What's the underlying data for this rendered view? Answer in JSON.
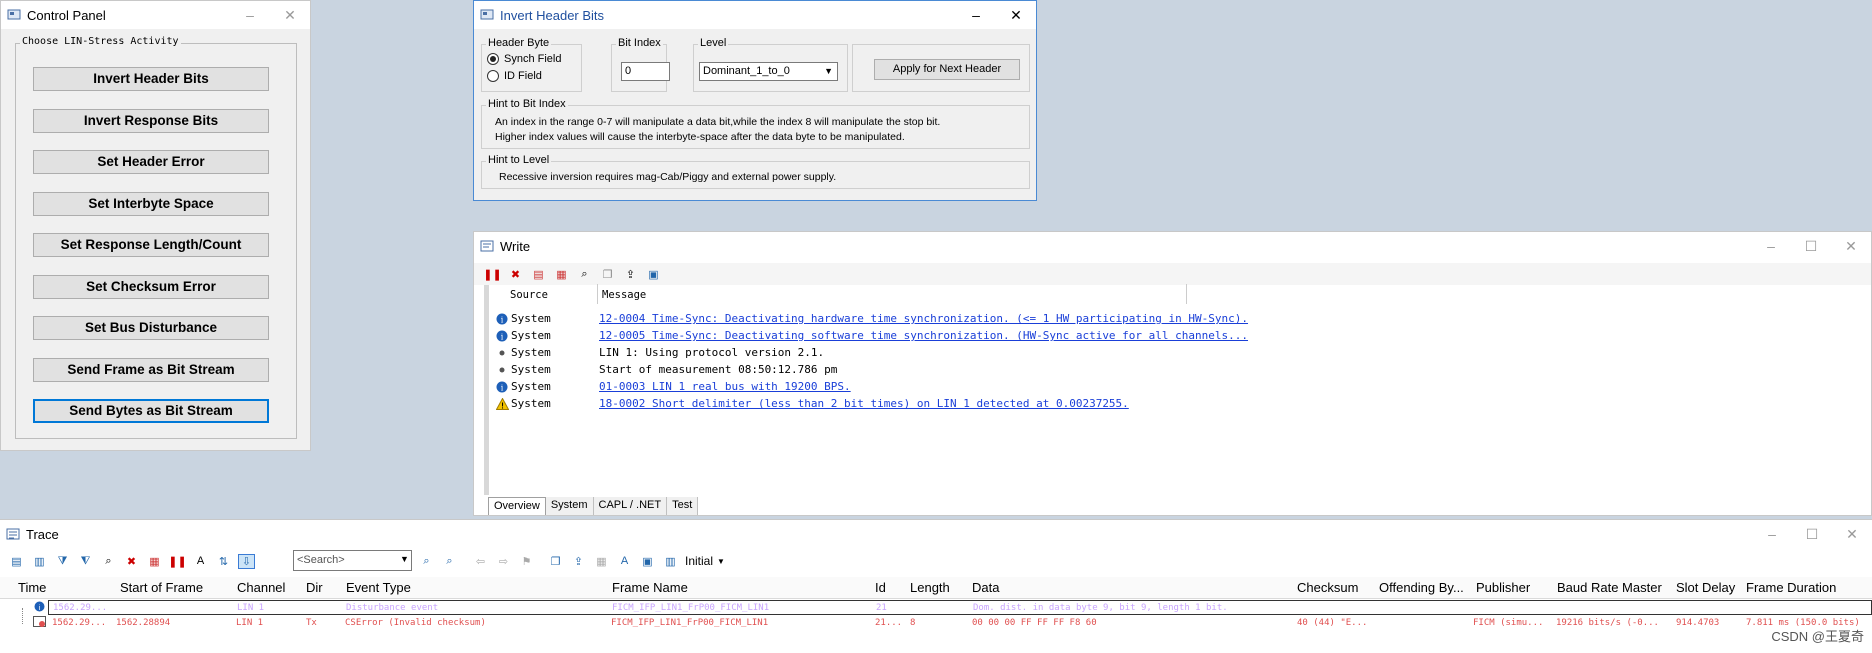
{
  "control_panel": {
    "title": "Control Panel",
    "group_label": "Choose LIN-Stress Activity",
    "buttons": [
      "Invert Header Bits",
      "Invert Response Bits",
      "Set Header Error",
      "Set Interbyte Space",
      "Set Response Length/Count",
      "Set Checksum Error",
      "Set Bus Disturbance",
      "Send Frame as Bit Stream",
      "Send Bytes as Bit Stream"
    ]
  },
  "invert_header": {
    "title": "Invert Header Bits",
    "header_byte_label": "Header Byte",
    "radio_synch": "Synch Field",
    "radio_id": "ID Field",
    "bit_index_label": "Bit Index",
    "bit_index_value": "0",
    "level_label": "Level",
    "level_value": "Dominant_1_to_0",
    "apply_button": "Apply for Next Header",
    "hint_bit_label": "Hint to Bit Index",
    "hint_bit_line1": "An index in the range 0-7 will manipulate a data bit,while the index 8 will manipulate the stop bit.",
    "hint_bit_line2": "Higher index values will cause the interbyte-space after the data byte to be manipulated.",
    "hint_level_label": "Hint to Level",
    "hint_level_text": "Recessive inversion requires mag-Cab/Piggy and external power supply."
  },
  "write": {
    "title": "Write",
    "col_source": "Source",
    "col_message": "Message",
    "rows": [
      {
        "icon": "info",
        "source": "System",
        "message": "12-0004 Time-Sync: Deactivating hardware time synchronization. (<= 1 HW participating in HW-Sync).",
        "link": true
      },
      {
        "icon": "info",
        "source": "System",
        "message": "12-0005 Time-Sync: Deactivating software time synchronization. (HW-Sync active for all channels...",
        "link": true
      },
      {
        "icon": "dot",
        "source": "System",
        "message": "LIN 1: Using protocol version 2.1.",
        "link": false
      },
      {
        "icon": "dot",
        "source": "System",
        "message": "Start of measurement 08:50:12.786 pm",
        "link": false
      },
      {
        "icon": "info",
        "source": "System",
        "message": "01-0003 LIN 1   real bus with 19200 BPS.",
        "link": true
      },
      {
        "icon": "warning",
        "source": "System",
        "message": "18-0002 Short delimiter (less than 2 bit times) on LIN 1 detected at 0.00237255.",
        "link": true
      }
    ],
    "tabs": [
      "Overview",
      "System",
      "CAPL / .NET",
      "Test"
    ]
  },
  "trace": {
    "title": "Trace",
    "search_placeholder": "<Search>",
    "initial_label": "Initial",
    "columns": [
      "Time",
      "Start of Frame",
      "Channel",
      "Dir",
      "Event Type",
      "Frame Name",
      "Id",
      "Length",
      "Data",
      "Checksum",
      "Offending By...",
      "Publisher",
      "Baud Rate Master",
      "Slot Delay",
      "Frame Duration"
    ],
    "rows": [
      {
        "time": "1562.29...",
        "sof": "",
        "channel": "LIN 1",
        "dir": "",
        "event": "Disturbance event",
        "frame": "FICM_IFP_LIN1_FrP00_FICM_LIN1",
        "id": "21",
        "length": "",
        "data": "Dom. dist. in data byte 9, bit 9, length 1 bit.",
        "checksum": "",
        "offending": "",
        "publisher": "",
        "baud": "",
        "slot": "",
        "duration": ""
      },
      {
        "time": "1562.29...",
        "sof": "1562.28894",
        "channel": "LIN 1",
        "dir": "Tx",
        "event": "CSError (Invalid checksum)",
        "frame": "FICM_IFP_LIN1_FrP00_FICM_LIN1",
        "id": "21...",
        "length": "8",
        "data": "00 00 00 FF FF FF F8 60",
        "checksum": "40 (44) \"E...",
        "offending": "",
        "publisher": "FICM (simu...",
        "baud": "19216 bits/s (-0...",
        "slot": "914.4703",
        "duration": "7.811 ms (150.0 bits)"
      }
    ]
  },
  "watermark": "CSDN @王夏奇",
  "colors": {
    "link": "#1a3fd8",
    "accent": "#0078d7",
    "trace_error": "#e05050"
  }
}
